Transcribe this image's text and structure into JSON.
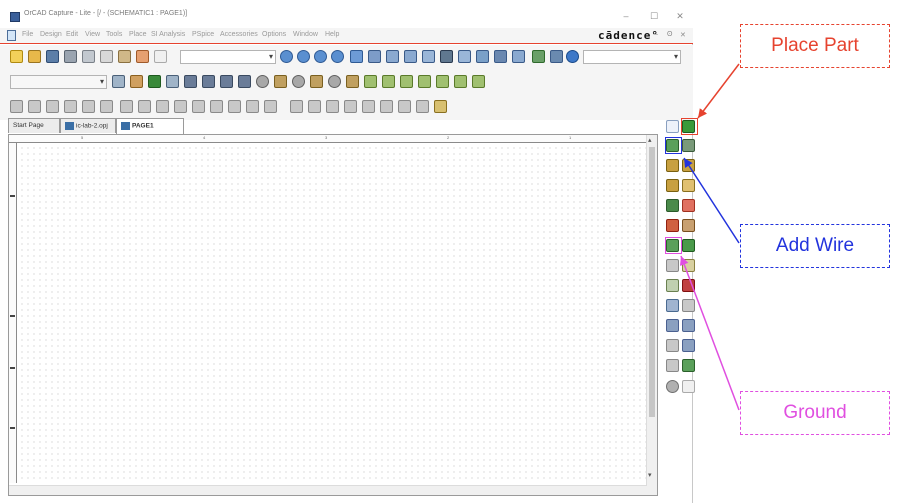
{
  "window": {
    "title": "OrCAD Capture - Lite - [/ - (SCHEMATIC1 : PAGE1)]",
    "controls": {
      "minimize": "–",
      "maximize": "☐",
      "close": "✕"
    }
  },
  "menu": {
    "items": [
      "File",
      "Design",
      "Edit",
      "View",
      "Tools",
      "Place",
      "SI Analysis",
      "PSpice",
      "Accessories",
      "Options",
      "Window",
      "Help"
    ],
    "brand": "cādence°",
    "mdi_controls": [
      "–",
      "ʘ",
      "✕"
    ]
  },
  "tabs": {
    "start_page": "Start Page",
    "project": "ic-lab-2.opj",
    "page": "PAGE1"
  },
  "ruler": {
    "top_numbers": [
      "5",
      "4",
      "3",
      "2",
      "1"
    ]
  },
  "callouts": {
    "place_part": "Place Part",
    "add_wire": "Add Wire",
    "ground": "Ground"
  },
  "colors": {
    "place_part": "#e6432f",
    "add_wire": "#2233dd",
    "ground": "#e04fe0",
    "menu_underline": "#e6432f"
  },
  "icons": {
    "toolbar1": [
      "new-icon",
      "open-icon",
      "save-icon",
      "print-icon",
      "cut-icon",
      "copy-icon",
      "paste-icon",
      "undo-icon",
      "redo-icon"
    ],
    "palette": [
      "select-icon",
      "place-part-icon",
      "place-wire-icon",
      "place-bus-icon",
      "place-net-alias-icon",
      "place-power-icon",
      "place-ground-icon",
      "place-junction-icon",
      "no-connect-icon"
    ]
  }
}
